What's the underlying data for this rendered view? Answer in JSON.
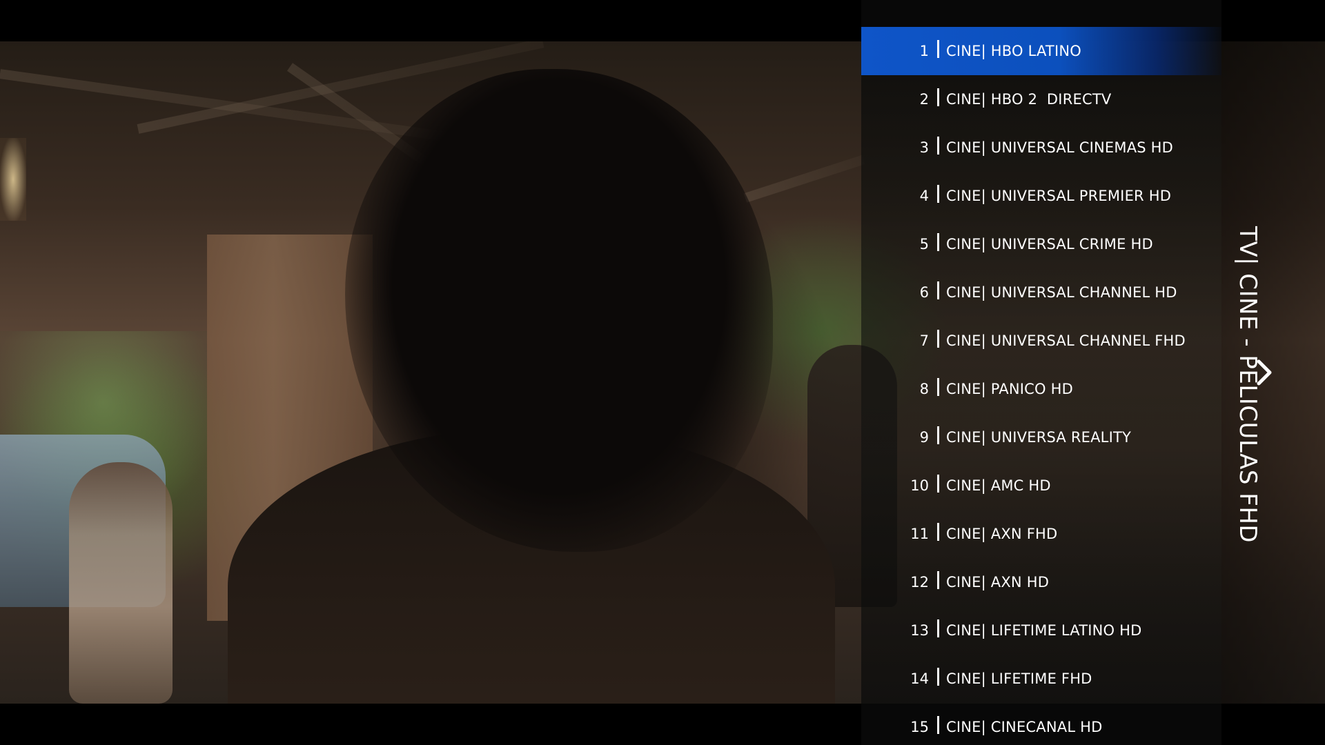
{
  "channel_list": {
    "selected_index": 0,
    "items": [
      {
        "number": "1",
        "name": "CINE| HBO LATINO"
      },
      {
        "number": "2",
        "name": "CINE| HBO 2  DIRECTV"
      },
      {
        "number": "3",
        "name": "CINE| UNIVERSAL CINEMAS HD"
      },
      {
        "number": "4",
        "name": "CINE| UNIVERSAL PREMIER HD"
      },
      {
        "number": "5",
        "name": "CINE| UNIVERSAL CRIME HD"
      },
      {
        "number": "6",
        "name": "CINE| UNIVERSAL CHANNEL HD"
      },
      {
        "number": "7",
        "name": "CINE| UNIVERSAL CHANNEL FHD"
      },
      {
        "number": "8",
        "name": "CINE| PANICO HD"
      },
      {
        "number": "9",
        "name": "CINE| UNIVERSA REALITY"
      },
      {
        "number": "10",
        "name": "CINE| AMC HD"
      },
      {
        "number": "11",
        "name": "CINE| AXN FHD"
      },
      {
        "number": "12",
        "name": "CINE| AXN HD"
      },
      {
        "number": "13",
        "name": "CINE| LIFETIME LATINO HD"
      },
      {
        "number": "14",
        "name": "CINE| LIFETIME FHD"
      },
      {
        "number": "15",
        "name": "CINE| CINECANAL HD"
      }
    ]
  },
  "category": {
    "title": "TV| CINE - PELICULAS FHD",
    "next_icon": "chevron-right-icon"
  },
  "colors": {
    "selected_highlight": "#0f55c8",
    "text": "#ffffff"
  }
}
